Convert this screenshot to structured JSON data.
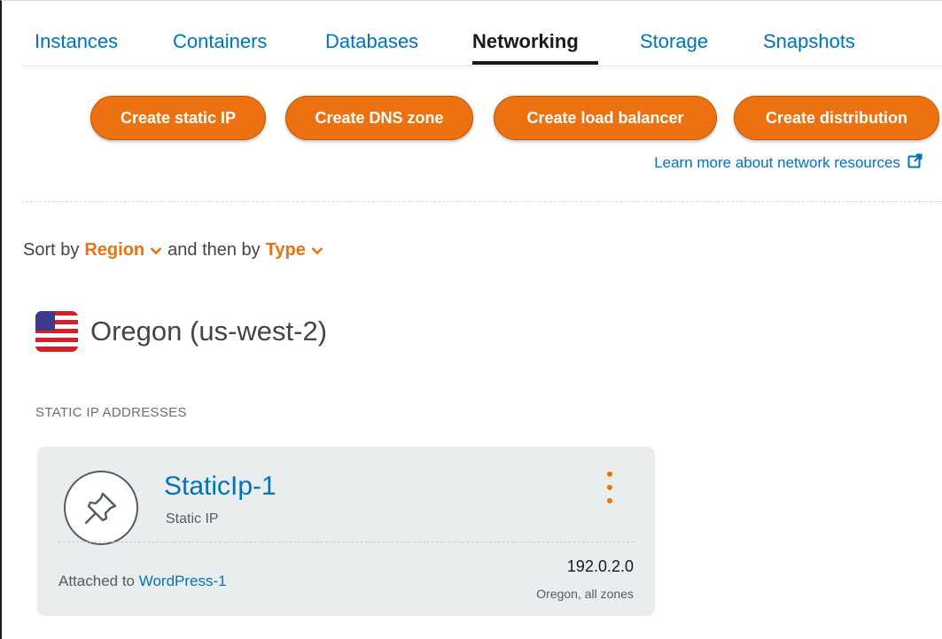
{
  "tabs": [
    {
      "label": "Instances",
      "active": false
    },
    {
      "label": "Containers",
      "active": false
    },
    {
      "label": "Databases",
      "active": false
    },
    {
      "label": "Networking",
      "active": true
    },
    {
      "label": "Storage",
      "active": false
    },
    {
      "label": "Snapshots",
      "active": false
    }
  ],
  "actions": {
    "create_static_ip": "Create static IP",
    "create_dns_zone": "Create DNS zone",
    "create_load_balancer": "Create load balancer",
    "create_distribution": "Create distribution"
  },
  "learn_more": "Learn more about network resources",
  "sort": {
    "prefix": "Sort by",
    "primary": "Region",
    "middle": "and then by",
    "secondary": "Type"
  },
  "region": {
    "name": "Oregon (us-west-2)",
    "flag_icon": "us-flag-icon"
  },
  "section_label": "STATIC IP ADDRESSES",
  "card": {
    "name": "StaticIp-1",
    "type": "Static IP",
    "icon": "pushpin-icon",
    "attached_prefix": "Attached to",
    "attached_instance": "WordPress-1",
    "ip": "192.0.2.0",
    "location": "Oregon, all zones"
  },
  "colors": {
    "accent": "#ec7211",
    "link": "#0073bb",
    "card_bg": "#eaeded"
  }
}
